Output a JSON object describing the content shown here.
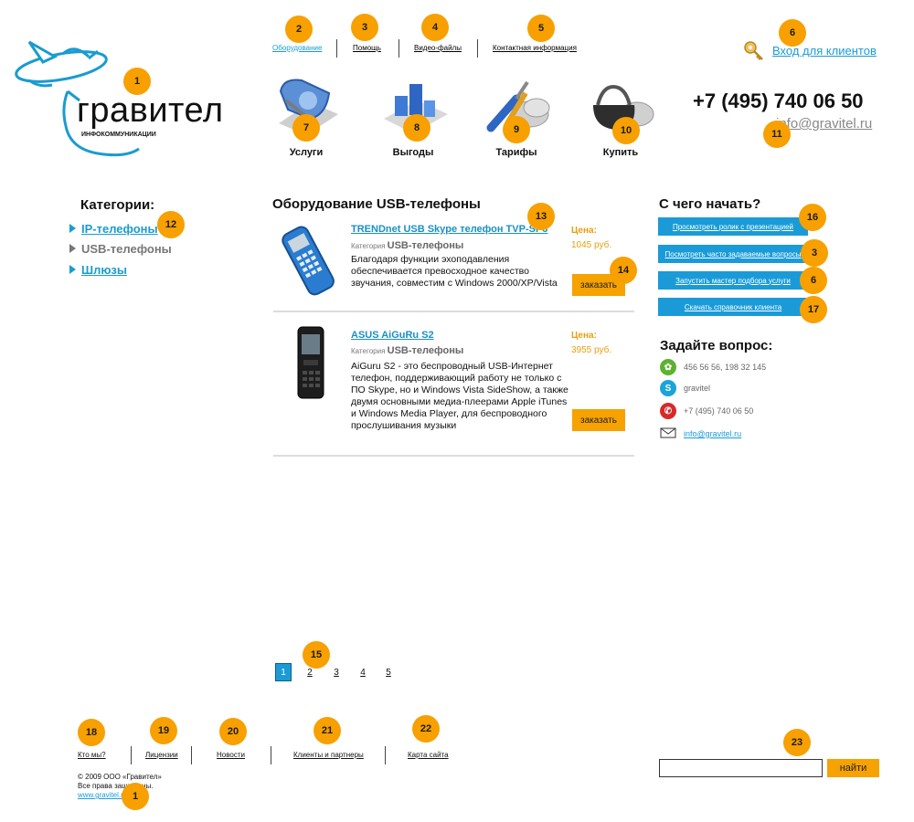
{
  "brand": {
    "logo_name": "гравител",
    "logo_sub": "ИНФОКОММУНИКАЦИИ"
  },
  "topnav": {
    "items": [
      "Оборудование",
      "Помощь",
      "Видео-файлы",
      "Контактная информация"
    ]
  },
  "login": {
    "label": "Вход для клиентов"
  },
  "contacts_header": {
    "phone": "+7 (495) 740 06 50",
    "email": "info@gravitel.ru"
  },
  "mainnav": {
    "items": [
      {
        "label": "Услуги",
        "icon": "services-icon"
      },
      {
        "label": "Выгоды",
        "icon": "benefits-icon"
      },
      {
        "label": "Тарифы",
        "icon": "tariffs-icon"
      },
      {
        "label": "Купить",
        "icon": "buy-icon"
      }
    ]
  },
  "categories": {
    "title": "Категории:",
    "items": [
      {
        "label": "IP-телефоны",
        "active": true
      },
      {
        "label": "USB-телефоны",
        "active": false
      },
      {
        "label": "Шлюзы",
        "active": true
      }
    ]
  },
  "main": {
    "title": "Оборудование USB-телефоны",
    "products": [
      {
        "name": "TRENDnet USB Skype телефон TVP-SP3",
        "category_label": "Категория",
        "category": "USB-телефоны",
        "description": "Благодаря функции эхоподавления обеспечивается превосходное качество звучания, совместим с Windows 2000/XP/Vista",
        "price_label": "Цена:",
        "price": "1045 руб.",
        "order_label": "заказать"
      },
      {
        "name": "ASUS AiGuRu S2",
        "category_label": "Категория",
        "category": "USB-телефоны",
        "description": "AiGuru S2 - это беспроводный USB-Интернет телефон, поддерживающий работу не только с ПО Skype, но и Windows Vista SideShow, а также двумя основными медиа-плеерами Apple iTunes и Windows Media Player, для беспроводного прослушивания музыки",
        "price_label": "Цена:",
        "price": "3955 руб.",
        "order_label": "заказать"
      }
    ],
    "pagination": [
      "1",
      "2",
      "3",
      "4",
      "5"
    ],
    "current_page": "1"
  },
  "start": {
    "title": "С чего начать?",
    "buttons": [
      "Просмотреть ролик с презентацией",
      "Посмотреть часто задаваемые вопросы",
      "Запустить мастер подбора услуги",
      "Скачать справочник клиента"
    ]
  },
  "ask": {
    "title": "Задайте вопрос:",
    "icq": "456 56 56, 198 32 145",
    "skype": "gravitel",
    "phone": "+7 (495) 740 06 50",
    "email": "info@gravitel.ru"
  },
  "footer": {
    "links": [
      "Кто мы?",
      "Лицензии",
      "Новости",
      "Клиенты и партнеры",
      "Карта сайта"
    ],
    "copyright": "© 2009 ООО «Гравител»",
    "rights": "Все права защищены.",
    "site": "www.gravitel.ru",
    "search_button": "найти"
  },
  "annotations": [
    "1",
    "2",
    "3",
    "4",
    "5",
    "6",
    "7",
    "8",
    "9",
    "10",
    "11",
    "12",
    "13",
    "14",
    "15",
    "6",
    "3",
    "16",
    "17",
    "18",
    "19",
    "20",
    "21",
    "22",
    "23",
    "1"
  ],
  "colors": {
    "accent": "#f7a000",
    "link_blue": "#1a9bd8"
  }
}
